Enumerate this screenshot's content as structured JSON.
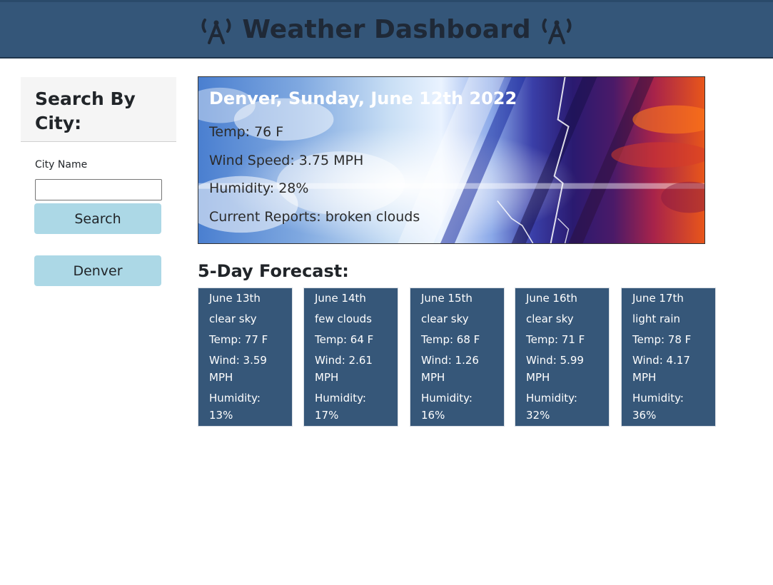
{
  "header": {
    "title": "Weather Dashboard",
    "left_icon": "antenna-icon",
    "right_icon": "antenna-icon"
  },
  "sidebar": {
    "title": "Search By City:",
    "input_label": "City Name",
    "input_value": "",
    "search_button": "Search",
    "history": [
      "Denver"
    ]
  },
  "current": {
    "title": "Denver, Sunday, June 12th 2022",
    "temp": "Temp: 76 F",
    "wind": "Wind Speed: 3.75 MPH",
    "humidity": "Humidity: 28%",
    "reports": "Current Reports: broken clouds"
  },
  "forecast": {
    "heading": "5-Day Forecast:",
    "days": [
      {
        "date": "June 13th",
        "desc": "clear sky",
        "temp": "Temp: 77 F",
        "wind": "Wind: 3.59 MPH",
        "humidity": "Humidity: 13%"
      },
      {
        "date": "June 14th",
        "desc": "few clouds",
        "temp": "Temp: 64 F",
        "wind": "Wind: 2.61 MPH",
        "humidity": "Humidity: 17%"
      },
      {
        "date": "June 15th",
        "desc": "clear sky",
        "temp": "Temp: 68 F",
        "wind": "Wind: 1.26 MPH",
        "humidity": "Humidity: 16%"
      },
      {
        "date": "June 16th",
        "desc": "clear sky",
        "temp": "Temp: 71 F",
        "wind": "Wind: 5.99 MPH",
        "humidity": "Humidity: 32%"
      },
      {
        "date": "June 17th",
        "desc": "light rain",
        "temp": "Temp: 78 F",
        "wind": "Wind: 4.17 MPH",
        "humidity": "Humidity: 36%"
      }
    ]
  },
  "colors": {
    "header_bg": "#345679",
    "card_bg": "#365779",
    "button_bg": "#acd8e6"
  }
}
